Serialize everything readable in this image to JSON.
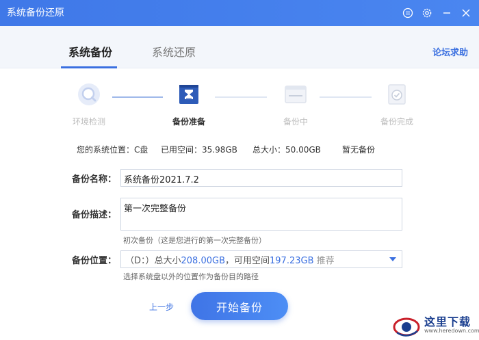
{
  "window": {
    "title": "系统备份还原"
  },
  "tabs": {
    "active": "系统备份",
    "inactive": "系统还原",
    "help": "论坛求助"
  },
  "steps": [
    {
      "label": "环境检测"
    },
    {
      "label": "备份准备"
    },
    {
      "label": "备份中"
    },
    {
      "label": "备份完成"
    }
  ],
  "info": {
    "location": "您的系统位置：C盘",
    "used": "已用空间：35.98GB",
    "total": "总大小：50.00GB",
    "backup": "暂无备份"
  },
  "form": {
    "name_label": "备份名称：",
    "name_value": "系统备份2021.7.2",
    "desc_label": "备份描述：",
    "desc_value": "第一次完整备份",
    "desc_hint": "初次备份（这是您进行的第一次完整备份）",
    "loc_label": "备份位置：",
    "loc_prefix": "（D：）总大小",
    "loc_total": "208.00GB",
    "loc_mid": "，可用空间",
    "loc_free": "197.23GB",
    "loc_tag": " 推荐",
    "loc_hint": "选择系统盘以外的位置作为备份目的路径"
  },
  "buttons": {
    "prev": "上一步",
    "start": "开始备份"
  },
  "watermark": {
    "text": "这里下载",
    "url": "www.heredown.com"
  },
  "colors": {
    "accent": "#3a6fe0",
    "titlebar": "#4a86f0"
  }
}
